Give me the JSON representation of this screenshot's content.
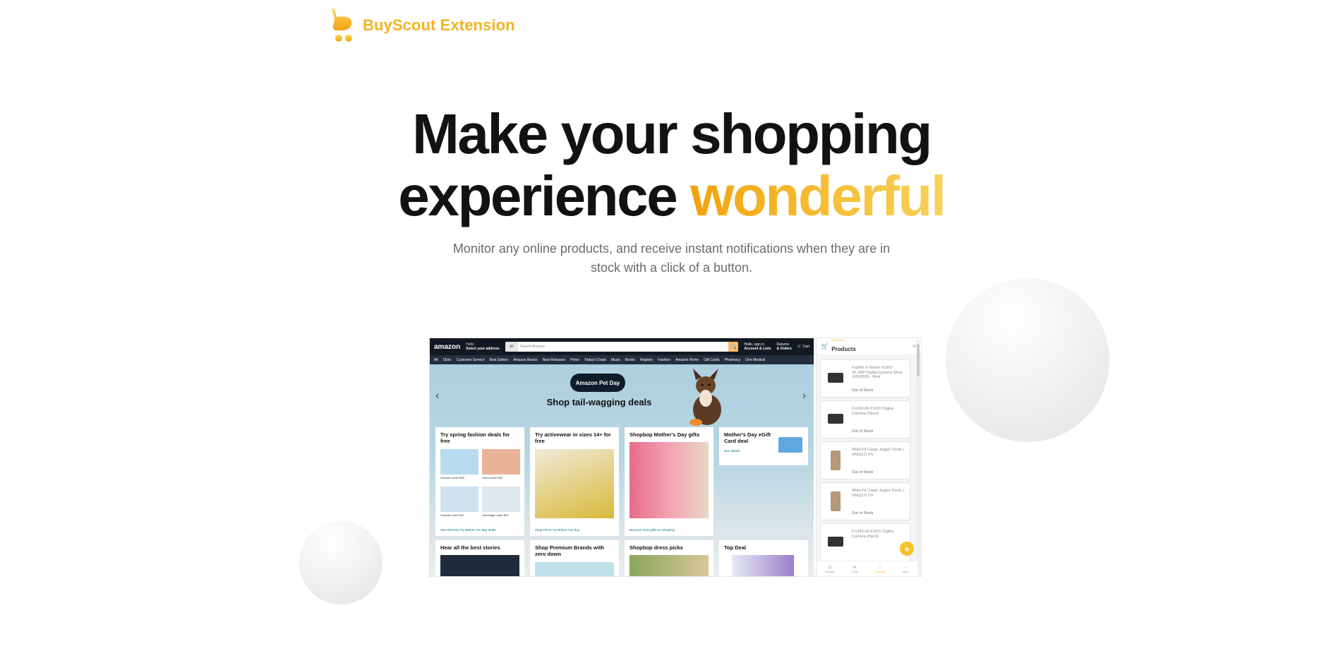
{
  "brand": {
    "name": "BuyScout Extension"
  },
  "hero": {
    "title_line1": "Make your shopping",
    "title_line2_plain": "experience ",
    "title_line2_accent": "wonderful",
    "subtitle_line1": "Monitor any online products, and receive instant notifications when they are in",
    "subtitle_line2": "stock with a click of a button."
  },
  "colors": {
    "accent": "#f3b322",
    "title": "#121212",
    "subtitle": "#6b6b6b"
  },
  "mock": {
    "amazon": {
      "logo": "amazon",
      "deliver_hello": "Hello",
      "deliver_address": "Select your address",
      "search_all": "All",
      "search_placeholder": "Search Amazon",
      "account_line1": "Hello, sign in",
      "account_line2": "Account & Lists",
      "returns_line1": "Returns",
      "returns_line2": "& Orders",
      "cart": "Cart",
      "nav": [
        "All",
        "Clinic",
        "Customer Service",
        "Best Sellers",
        "Amazon Basics",
        "New Releases",
        "Prime",
        "Today's Deals",
        "Music",
        "Books",
        "Registry",
        "Fashion",
        "Amazon Home",
        "Gift Cards",
        "Pharmacy",
        "One Medical"
      ],
      "pet_tag": "Amazon Pet Day",
      "pet_headline": "Shop tail-wagging deals",
      "cards": [
        {
          "title": "Try spring fashion deals for free",
          "link": "See all Prime Try Before You Buy deals",
          "captions": [
            "Dresses under $35",
            "Swim under $30",
            "Sandals under $40",
            "Handbags under $25"
          ]
        },
        {
          "title": "Try activewear in sizes 14+ for free",
          "link": "Shop Prime Try Before You Buy"
        },
        {
          "title": "Shopbop Mother's Day gifts",
          "link": "Discover more gifts on Shopbop"
        },
        {
          "title": "Mother's Day eGift Card deal",
          "link": "See details"
        },
        {
          "title": "Hear all the best stories"
        },
        {
          "title": "Shop Premium Brands with zero down"
        },
        {
          "title": "Shopbop dress picks"
        },
        {
          "title": "Top Deal"
        }
      ]
    },
    "extension": {
      "brand_small": "BuyScout",
      "header": "Products",
      "items": [
        {
          "name": "Fujifilm X-Series X100V 26.1MP Digital Camera Silver 16642939 - Best",
          "status": "Out of Stock"
        },
        {
          "name": "FUJIFILM X100V Digital Camera (Silver)",
          "status": "Out of Stock"
        },
        {
          "name": "Wide-Fit Cargo Jogger Pants | UNIQLO US",
          "status": "Out of Stock"
        },
        {
          "name": "Wide-Fit Cargo Jogger Pants | UNIQLO US",
          "status": "Out of Stock"
        },
        {
          "name": "FUJIFILM X100V Digital Camera (Black)",
          "status": ""
        }
      ],
      "fab": "+",
      "tabs": [
        "Explore",
        "Chat",
        "Products",
        "More"
      ]
    }
  }
}
